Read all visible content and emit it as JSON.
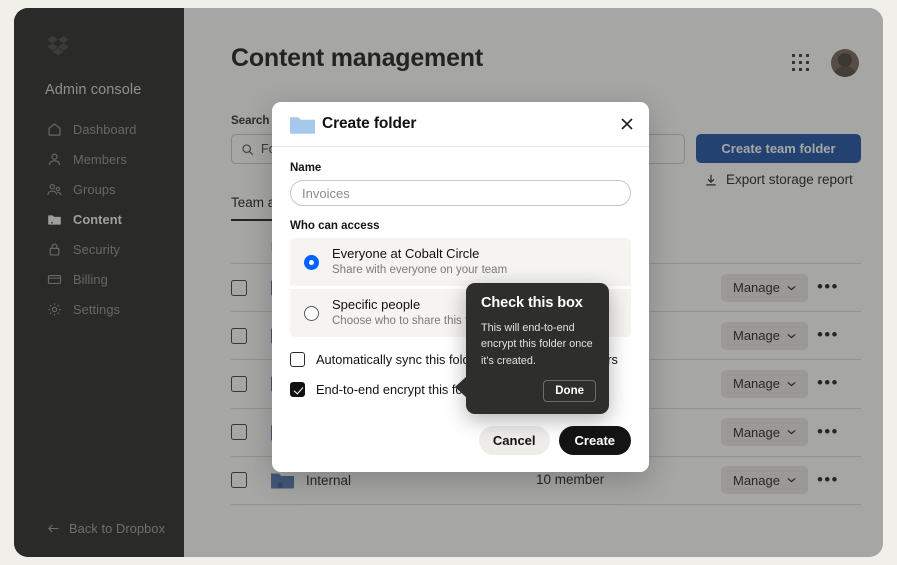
{
  "app": {
    "sidebar": {
      "logo_icon": "dropbox-logo-icon",
      "title": "Admin console",
      "items": [
        {
          "label": "Dashboard",
          "icon": "home-icon",
          "active": false
        },
        {
          "label": "Members",
          "icon": "person-icon",
          "active": false
        },
        {
          "label": "Groups",
          "icon": "people-icon",
          "active": false
        },
        {
          "label": "Content",
          "icon": "folder-icon",
          "active": true
        },
        {
          "label": "Security",
          "icon": "lock-icon",
          "active": false
        },
        {
          "label": "Billing",
          "icon": "card-icon",
          "active": false
        },
        {
          "label": "Settings",
          "icon": "gear-icon",
          "active": false
        }
      ],
      "back_link": {
        "label": "Back to Dropbox",
        "icon": "arrow-left-icon"
      }
    },
    "header": {
      "title": "Content management",
      "grid_icon": "apps-grid-icon",
      "avatar_icon": "user-avatar"
    },
    "toolbar": {
      "search_label": "Search",
      "search_value": "Fo",
      "search_placeholder": "Folder name",
      "search_icon": "search-icon",
      "create_team_folder_label": "Create team folder",
      "create_team_folder_color": "#0d47a1",
      "export_report_label": "Export storage report",
      "export_report_icon": "download-icon"
    },
    "tabs": [
      {
        "label": "Team a",
        "active": true
      }
    ],
    "table": {
      "columns": [
        "",
        "Name",
        "",
        "",
        ""
      ],
      "name_header": "Nam",
      "rows": [
        {
          "name": "",
          "members": "",
          "manage_label": "Manage",
          "more_label": "•••",
          "folder_icon": "team-folder-icon",
          "checked": false
        },
        {
          "name": "",
          "members": "",
          "manage_label": "Manage",
          "more_label": "•••",
          "folder_icon": "team-folder-icon",
          "checked": false
        },
        {
          "name": "",
          "members": "",
          "manage_label": "Manage",
          "more_label": "•••",
          "folder_icon": "team-folder-icon",
          "checked": false
        },
        {
          "name": "",
          "members": "",
          "manage_label": "Manage",
          "more_label": "•••",
          "folder_icon": "shared-folder-icon",
          "checked": false
        },
        {
          "name": "Internal",
          "members": "10 member",
          "manage_label": "Manage",
          "more_label": "•••",
          "folder_icon": "team-folder-icon",
          "checked": false
        }
      ]
    }
  },
  "dialog": {
    "title": "Create folder",
    "folder_icon": "folder-icon",
    "close_icon": "close-icon",
    "name_label": "Name",
    "name_value": "",
    "name_placeholder": "Invoices",
    "access_label": "Who can access",
    "access_options": [
      {
        "title": "Everyone at Cobalt Circle",
        "subtitle": "Share with everyone on your team",
        "selected": true
      },
      {
        "title": "Specific people",
        "subtitle": "Choose who to share this folder with",
        "selected": false
      }
    ],
    "checkboxes": [
      {
        "label": "Automatically sync this folder to members' computers",
        "checked": false
      },
      {
        "label": "End-to-end encrypt this folder",
        "checked": true
      }
    ],
    "cancel_label": "Cancel",
    "create_label": "Create",
    "accent_color": "#0062ff"
  },
  "coachmark": {
    "title": "Check this box",
    "body": "This will end-to-end encrypt this folder once it's created.",
    "done_label": "Done",
    "background_color": "#2e2e2c"
  }
}
